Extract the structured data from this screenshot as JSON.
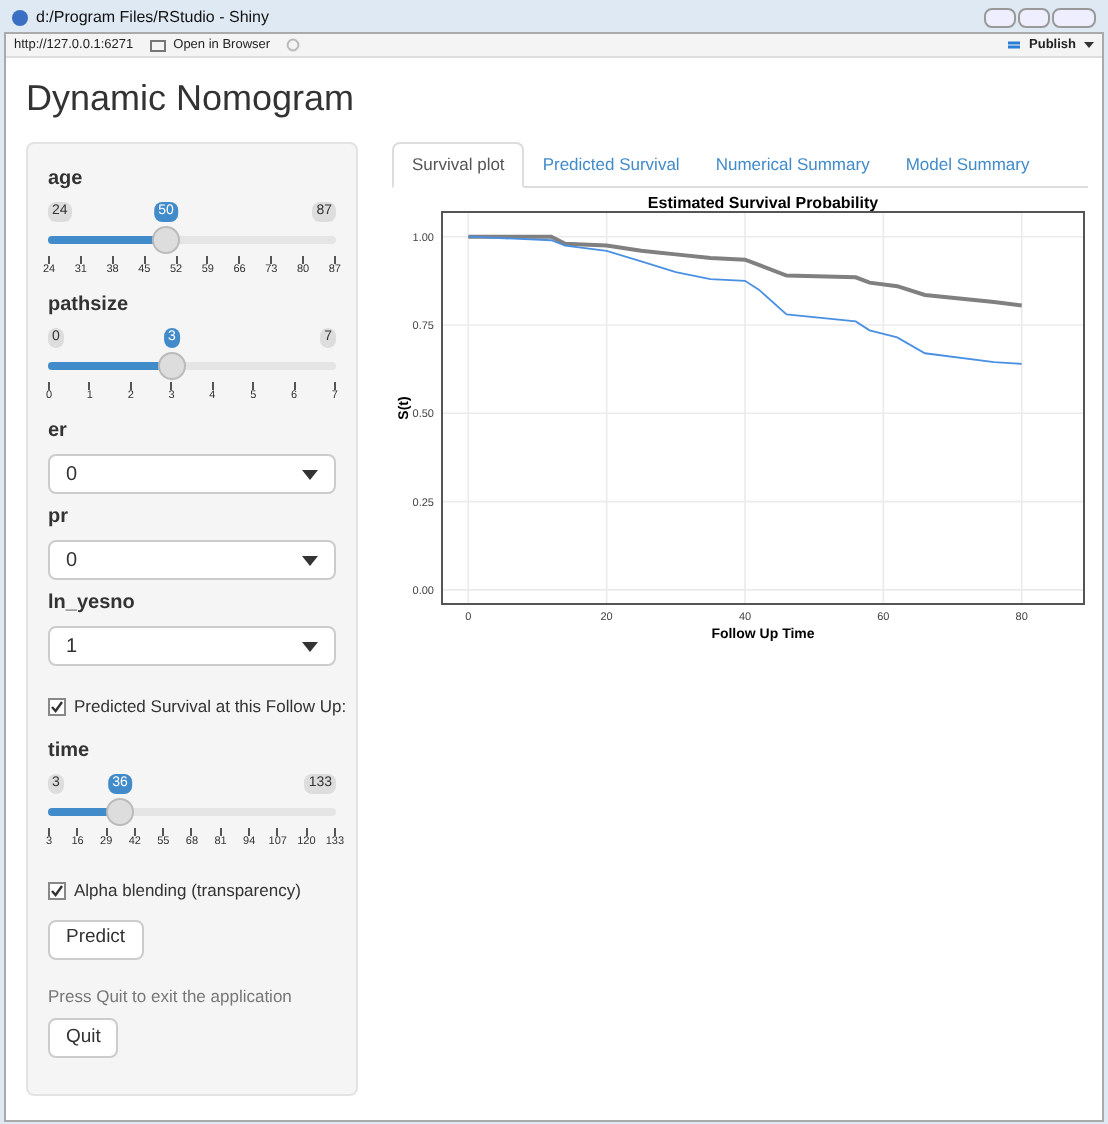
{
  "window": {
    "title": "d:/Program Files/RStudio - Shiny"
  },
  "toolbar": {
    "url": "http://127.0.0.1:6271",
    "open_in_browser": "Open in Browser",
    "publish": "Publish"
  },
  "app": {
    "title": "Dynamic Nomogram"
  },
  "sidebar": {
    "controls": [
      {
        "kind": "slider",
        "label": "age",
        "min": "24",
        "max": "87",
        "value": "50",
        "level": 0.41,
        "ticks": [
          "24",
          "31",
          "38",
          "45",
          "52",
          "59",
          "66",
          "73",
          "80",
          "87"
        ]
      },
      {
        "kind": "slider",
        "label": "pathsize",
        "min": "0",
        "max": "7",
        "value": "3",
        "level": 0.43,
        "ticks": [
          "0",
          "1",
          "2",
          "3",
          "4",
          "5",
          "6",
          "7"
        ]
      },
      {
        "kind": "select",
        "label": "er",
        "value": "0"
      },
      {
        "kind": "select",
        "label": "pr",
        "value": "0"
      },
      {
        "kind": "select",
        "label": "ln_yesno",
        "value": "1"
      },
      {
        "kind": "checkbox",
        "label": "Predicted Survival at this Follow Up:",
        "checked": true
      },
      {
        "kind": "slider",
        "label": "time",
        "min": "3",
        "max": "133",
        "value": "36",
        "level": 0.25,
        "ticks": [
          "3",
          "16",
          "29",
          "42",
          "55",
          "68",
          "81",
          "94",
          "107",
          "120",
          "133"
        ]
      },
      {
        "kind": "checkbox",
        "label": "Alpha blending (transparency)",
        "checked": true
      },
      {
        "kind": "button",
        "label": "Predict"
      },
      {
        "kind": "note",
        "label": "Press Quit to exit the application"
      },
      {
        "kind": "button",
        "label": "Quit"
      }
    ]
  },
  "tabs": [
    {
      "label": "Survival plot",
      "selected": true
    },
    {
      "label": "Predicted Survival",
      "selected": false
    },
    {
      "label": "Numerical Summary",
      "selected": false
    },
    {
      "label": "Model Summary",
      "selected": false
    }
  ],
  "chart_data": {
    "type": "line",
    "title": "Estimated Survival Probability",
    "xlabel": "Follow Up Time",
    "ylabel": "S(t)",
    "x": [
      0,
      12,
      14,
      20,
      25,
      30,
      35,
      40,
      42,
      46,
      56,
      58,
      62,
      66,
      76,
      80
    ],
    "series": [
      {
        "color": "#808080",
        "values": [
          1,
          1,
          0.98,
          0.975,
          0.96,
          0.95,
          0.94,
          0.935,
          0.92,
          0.89,
          0.885,
          0.87,
          0.86,
          0.835,
          0.815,
          0.805
        ]
      },
      {
        "color": "#4a90e2",
        "values": [
          1,
          0.99,
          0.975,
          0.96,
          0.93,
          0.9,
          0.88,
          0.875,
          0.85,
          0.78,
          0.76,
          0.735,
          0.715,
          0.67,
          0.645,
          0.64
        ]
      }
    ],
    "grid": true,
    "xlim": [
      -3.8,
      89
    ],
    "ylim": [
      -0.04,
      1.07
    ],
    "xticks": [
      0,
      20,
      40,
      60,
      80
    ],
    "yticks": [
      {
        "value": 0,
        "label": "0.00"
      },
      {
        "value": 0.25,
        "label": "0.25"
      },
      {
        "value": 0.5,
        "label": "0.50"
      },
      {
        "value": 0.75,
        "label": "0.75"
      },
      {
        "value": 1,
        "label": "1.00"
      }
    ]
  }
}
